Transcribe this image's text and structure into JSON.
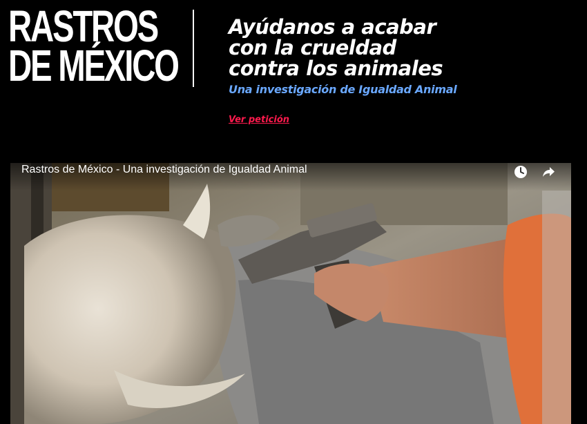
{
  "logo": {
    "line1": "RASTROS",
    "line2": "DE MÉXICO"
  },
  "headline": {
    "line1": "Ayúdanos a acabar",
    "line2": "con la crueldad",
    "line3": "contra los animales"
  },
  "subtitle": "Una investigación de Igualdad Animal",
  "petition_link": "Ver petición",
  "video": {
    "title": "Rastros de México - Una investigación de Igualdad Animal",
    "icons": [
      "clock-icon",
      "share-icon"
    ]
  },
  "colors": {
    "background": "#000000",
    "text": "#ffffff",
    "subtitle": "#6aa8ff",
    "link": "#ff1a4d"
  }
}
